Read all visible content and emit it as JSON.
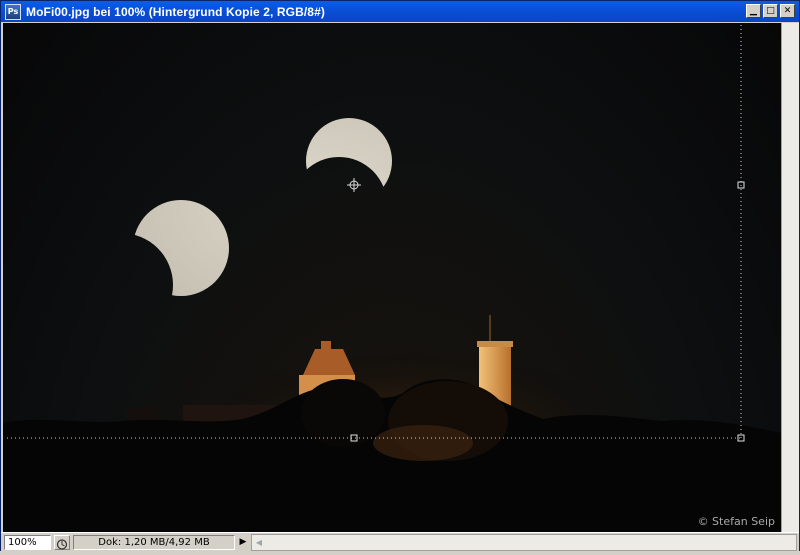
{
  "window": {
    "app_icon_text": "Ps",
    "title": "MoFi00.jpg bei 100% (Hintergrund Kopie 2, RGB/8#)",
    "minimize_glyph": "▁",
    "maximize_glyph": "□",
    "close_glyph": "✕"
  },
  "image": {
    "copyright": "© Stefan Seip"
  },
  "status": {
    "zoom": "100%",
    "doc_info": "Dok: 1,20 MB/4,92 MB",
    "menu_arrow": "▶",
    "scroll_left_arrow": "◀"
  },
  "colors": {
    "titlebar": "#0a4fd6",
    "sky": "#0d0f10",
    "castle_light": "#e8a050",
    "moon": "#c9c4b6"
  }
}
